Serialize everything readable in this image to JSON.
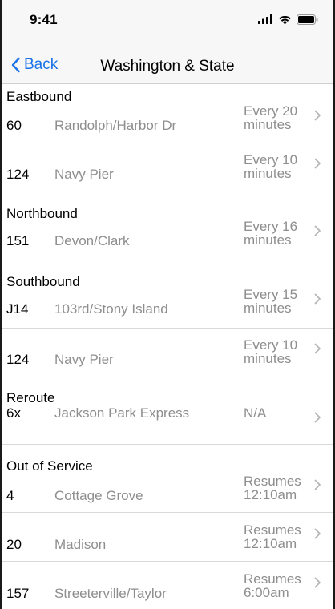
{
  "status_bar": {
    "time": "9:41"
  },
  "nav": {
    "back_label": "Back",
    "title": "Washington & State"
  },
  "colors": {
    "accent": "#1a73e8",
    "secondary_text": "#8e8e8e",
    "separator": "#d9d9d9"
  },
  "sections": [
    {
      "title": "Eastbound",
      "routes": [
        {
          "number": "60",
          "destination": "Randolph/Harbor Dr",
          "frequency_line1": "Every 20",
          "frequency_line2": "minutes"
        },
        {
          "number": "124",
          "destination": "Navy Pier",
          "frequency_line1": "Every 10",
          "frequency_line2": "minutes"
        }
      ]
    },
    {
      "title": "Northbound",
      "routes": [
        {
          "number": "151",
          "destination": "Devon/Clark",
          "frequency_line1": "Every 16",
          "frequency_line2": "minutes"
        }
      ]
    },
    {
      "title": "Southbound",
      "routes": [
        {
          "number": "J14",
          "destination": "103rd/Stony Island",
          "frequency_line1": "Every 15",
          "frequency_line2": "minutes"
        },
        {
          "number": "124",
          "destination": "Navy Pier",
          "frequency_line1": "Every 10",
          "frequency_line2": "minutes"
        }
      ]
    },
    {
      "title": "Reroute",
      "routes": [
        {
          "number": "6x",
          "destination": "Jackson Park Express",
          "frequency_line1": "N/A",
          "frequency_line2": ""
        }
      ]
    },
    {
      "title": "Out of Service",
      "routes": [
        {
          "number": "4",
          "destination": "Cottage Grove",
          "frequency_line1": "Resumes",
          "frequency_line2": "12:10am"
        },
        {
          "number": "20",
          "destination": "Madison",
          "frequency_line1": "Resumes",
          "frequency_line2": "12:10am"
        },
        {
          "number": "157",
          "destination": "Streeterville/Taylor",
          "frequency_line1": "Resumes",
          "frequency_line2": "6:00am"
        }
      ]
    }
  ]
}
